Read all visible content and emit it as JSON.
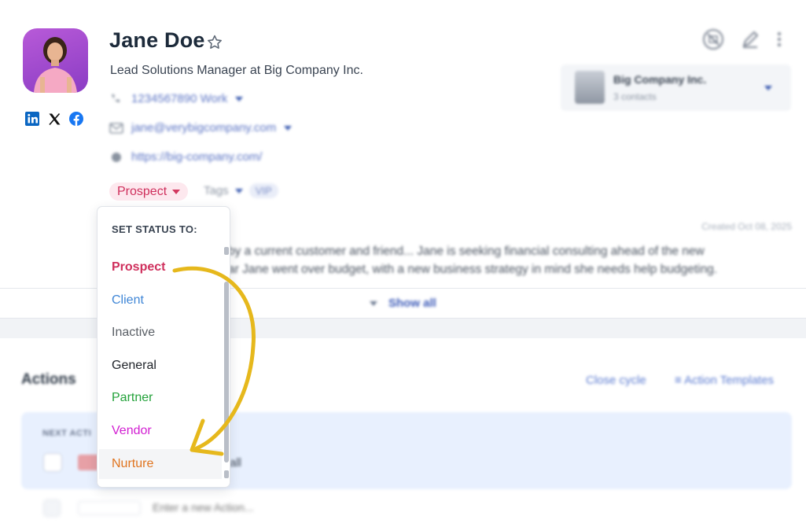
{
  "contact": {
    "name": "Jane Doe",
    "title": "Lead Solutions Manager at Big Company Inc.",
    "phone": "1234567890 Work",
    "email": "jane@verybigcompany.com",
    "website": "https://big-company.com/",
    "status": "Prospect",
    "tags_label": "Tags",
    "tag_vip": "VIP",
    "created": "Created Oct 08, 2025",
    "notes_line1": "by a current customer and friend... Jane is seeking financial consulting ahead of the new",
    "notes_line2": "ar Jane went over budget, with a new business strategy in mind she needs help budgeting."
  },
  "company": {
    "name": "Big Company Inc.",
    "contacts": "3 contacts"
  },
  "show_all": "Show all",
  "actions": {
    "heading": "Actions",
    "close_cycle": "Close cycle",
    "templates": "Action Templates",
    "next_label": "NEXT ACTI",
    "next_text": "all",
    "new_placeholder": "Enter a new Action..."
  },
  "status_menu": {
    "title": "SET STATUS TO:",
    "items": [
      {
        "label": "Prospect",
        "color": "#cf2f5c"
      },
      {
        "label": "Client",
        "color": "#3f86d6"
      },
      {
        "label": "Inactive",
        "color": "#5a5f66"
      },
      {
        "label": "General",
        "color": "#1f2329"
      },
      {
        "label": "Partner",
        "color": "#23a23a"
      },
      {
        "label": "Vendor",
        "color": "#d21fd2"
      },
      {
        "label": "Nurture",
        "color": "#e0741f"
      }
    ]
  },
  "colors": {
    "accent": "#3d5bb8",
    "status_prospect_bg": "#fde8ee",
    "arrow": "#e6b81c"
  }
}
